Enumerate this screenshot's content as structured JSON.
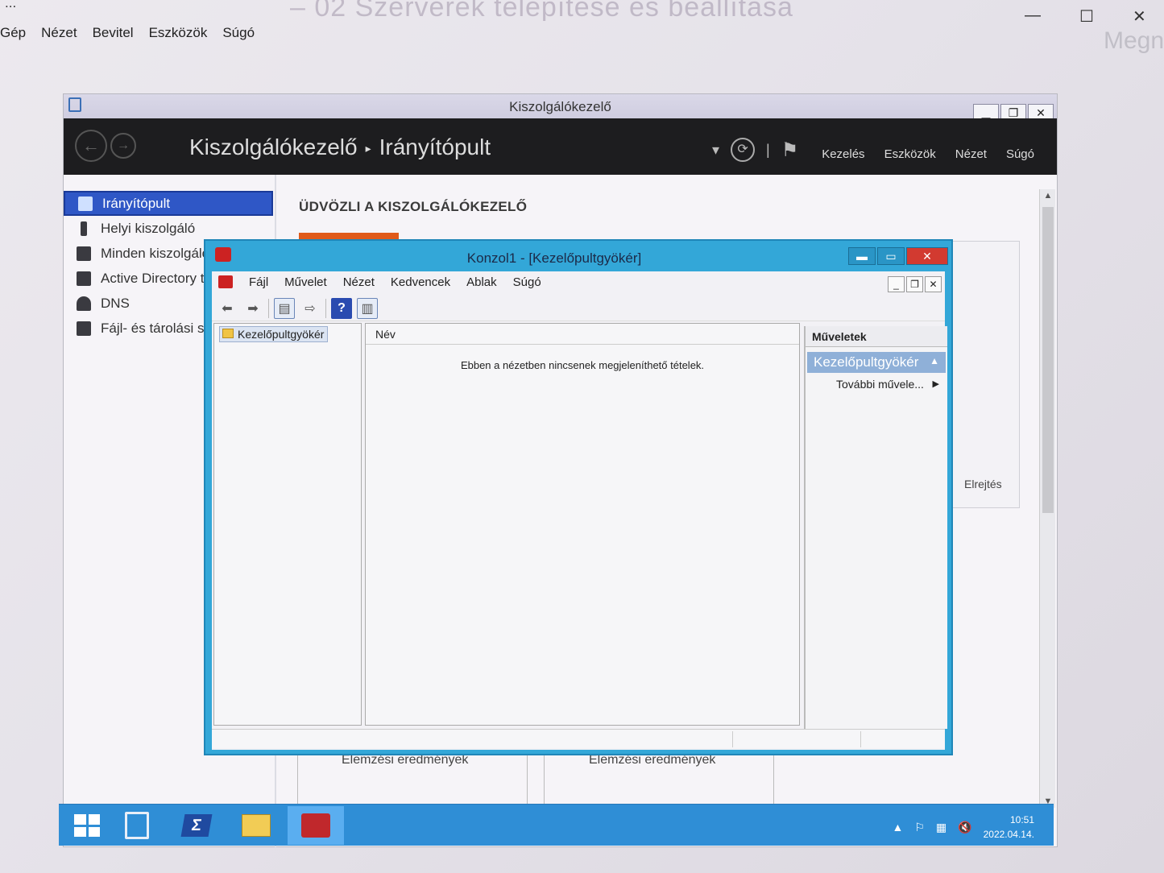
{
  "host": {
    "title_fragment": "...",
    "menu": [
      "Gép",
      "Nézet",
      "Bevitel",
      "Eszközök",
      "Súgó"
    ],
    "watermark": "Megn"
  },
  "server_manager": {
    "window_title": "Kiszolgálókezelő",
    "breadcrumb": [
      "Kiszolgálókezelő",
      "Irányítópult"
    ],
    "header_menu": [
      "Kezelés",
      "Eszközök",
      "Nézet",
      "Súgó"
    ],
    "nav": [
      {
        "label": "Irányítópult",
        "icon": "dashboard-icon",
        "selected": true
      },
      {
        "label": "Helyi kiszolgáló",
        "icon": "server-icon"
      },
      {
        "label": "Minden kiszolgáló",
        "icon": "servers-icon"
      },
      {
        "label": "Active Directory tartományi szolgáltatások",
        "icon": "ad-icon"
      },
      {
        "label": "DNS",
        "icon": "dns-icon"
      },
      {
        "label": "Fájl- és tárolási szolgáltatások",
        "icon": "file-storage-icon"
      }
    ],
    "welcome_title": "ÜDVÖZLI A KISZOLGÁLÓKEZELŐ",
    "hide_link": "Elrejtés",
    "tiles": [
      "Elemzési eredmények",
      "Elemzési eredmények"
    ]
  },
  "mmc": {
    "window_title": "Konzol1 - [Kezelőpultgyökér]",
    "menu": [
      "Fájl",
      "Művelet",
      "Nézet",
      "Kedvencek",
      "Ablak",
      "Súgó"
    ],
    "tree_root": "Kezelőpultgyökér",
    "list_column": "Név",
    "empty_message": "Ebben a nézetben nincsenek megjeleníthető tételek.",
    "actions_title": "Műveletek",
    "actions_section": "Kezelőpultgyökér",
    "actions_more": "További művele..."
  },
  "taskbar": {
    "time": "10:51",
    "date": "2022.04.14."
  },
  "colors": {
    "accent_blue": "#2f57c6",
    "mmc_frame": "#33a7d8",
    "taskbar": "#2f8ed6",
    "close_red": "#d23a30",
    "welcome_orange": "#e05a1a"
  }
}
